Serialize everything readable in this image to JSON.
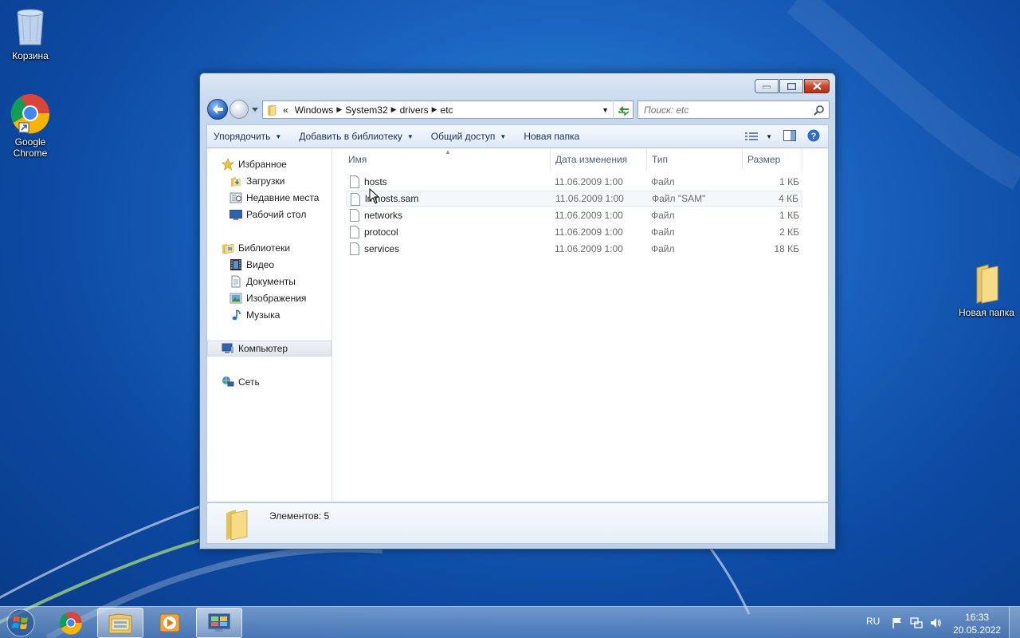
{
  "desktop": {
    "icons": [
      {
        "label": "Корзина"
      },
      {
        "label": "Google Chrome"
      },
      {
        "label": "Новая папка"
      }
    ]
  },
  "window": {
    "address": {
      "overflow": "«",
      "crumbs": [
        "Windows",
        "System32",
        "drivers",
        "etc"
      ]
    },
    "search": {
      "placeholder": "Поиск: etc"
    },
    "toolbar": {
      "organize": "Упорядочить",
      "add_library": "Добавить в библиотеку",
      "share": "Общий доступ",
      "new_folder": "Новая папка"
    },
    "nav": {
      "favorites": "Избранное",
      "downloads": "Загрузки",
      "recent": "Недавние места",
      "desktop": "Рабочий стол",
      "libraries": "Библиотеки",
      "video": "Видео",
      "documents": "Документы",
      "images": "Изображения",
      "music": "Музыка",
      "computer": "Компьютер",
      "network": "Сеть"
    },
    "columns": {
      "name": "Имя",
      "date": "Дата изменения",
      "type": "Тип",
      "size": "Размер"
    },
    "files": [
      {
        "name": "hosts",
        "date": "11.06.2009 1:00",
        "type": "Файл",
        "size": "1 КБ"
      },
      {
        "name": "lmhosts.sam",
        "date": "11.06.2009 1:00",
        "type": "Файл \"SAM\"",
        "size": "4 КБ"
      },
      {
        "name": "networks",
        "date": "11.06.2009 1:00",
        "type": "Файл",
        "size": "1 КБ"
      },
      {
        "name": "protocol",
        "date": "11.06.2009 1:00",
        "type": "Файл",
        "size": "2 КБ"
      },
      {
        "name": "services",
        "date": "11.06.2009 1:00",
        "type": "Файл",
        "size": "18 КБ"
      }
    ],
    "status": "Элементов: 5"
  },
  "taskbar": {
    "lang": "RU",
    "time": "16:33",
    "date": "20.05.2022"
  }
}
